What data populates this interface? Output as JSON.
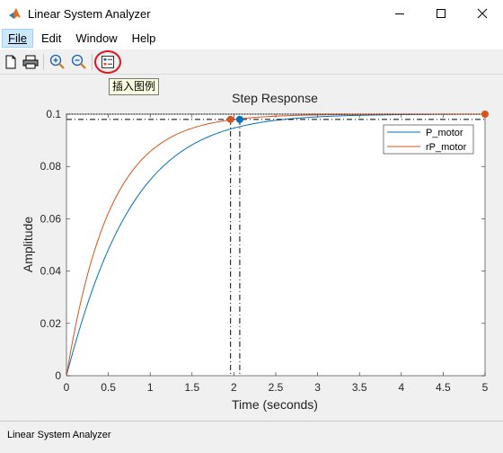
{
  "window": {
    "title": "Linear System Analyzer",
    "controls": [
      "minimize-icon",
      "maximize-icon",
      "close-icon"
    ]
  },
  "menu": [
    {
      "label": "File",
      "active": true
    },
    {
      "label": "Edit"
    },
    {
      "label": "Window"
    },
    {
      "label": "Help"
    }
  ],
  "toolbar": {
    "buttons": [
      "new-icon",
      "print-icon",
      "zoom-in-icon",
      "zoom-out-icon",
      "legend-icon"
    ],
    "tooltip": "插入图例",
    "highlight_color": "#e0151f"
  },
  "status": "Linear System Analyzer",
  "chart_data": {
    "type": "line",
    "title": "Step Response",
    "xlabel": "Time (seconds)",
    "ylabel": "Amplitude",
    "xlim": [
      0,
      5
    ],
    "ylim": [
      0,
      0.1
    ],
    "xticks": [
      "0",
      "0.5",
      "1",
      "1.5",
      "2",
      "2.5",
      "3",
      "3.5",
      "4",
      "4.5",
      "5"
    ],
    "yticks": [
      "0",
      "0.02",
      "0.04",
      "0.06",
      "0.08",
      "0.1"
    ],
    "grid": false,
    "legend_position": "top-right",
    "series": [
      {
        "name": "P_motor",
        "color": "#0072bd",
        "tau": 0.53,
        "x": [
          0,
          0.1,
          0.25,
          0.5,
          0.75,
          1.0,
          1.25,
          1.5,
          1.75,
          2.0,
          2.25,
          2.5,
          3.0,
          3.5,
          4.0,
          4.5,
          5.0
        ],
        "y": [
          0,
          0.003,
          0.017,
          0.043,
          0.063,
          0.078,
          0.087,
          0.092,
          0.0955,
          0.0975,
          0.0985,
          0.0991,
          0.0997,
          0.0999,
          0.1,
          0.1,
          0.1
        ]
      },
      {
        "name": "rP_motor",
        "color": "#d95319",
        "tau": 0.49,
        "x": [
          0,
          0.1,
          0.25,
          0.5,
          0.75,
          1.0,
          1.25,
          1.5,
          1.75,
          2.0,
          2.25,
          2.5,
          3.0,
          3.5,
          4.0,
          4.5,
          5.0
        ],
        "y": [
          0,
          0.012,
          0.03,
          0.053,
          0.07,
          0.081,
          0.089,
          0.093,
          0.096,
          0.098,
          0.0988,
          0.0993,
          0.0998,
          0.1,
          0.1,
          0.1,
          0.1
        ]
      }
    ],
    "markers": [
      {
        "series": "P_motor",
        "label": "settling",
        "x": 2.07,
        "y": 0.098
      },
      {
        "series": "rP_motor",
        "label": "settling",
        "x": 1.96,
        "y": 0.098
      },
      {
        "series": "rP_motor",
        "label": "steady-state",
        "x": 5.0,
        "y": 0.1
      }
    ],
    "settling_lines": [
      0.098,
      0.102
    ]
  }
}
